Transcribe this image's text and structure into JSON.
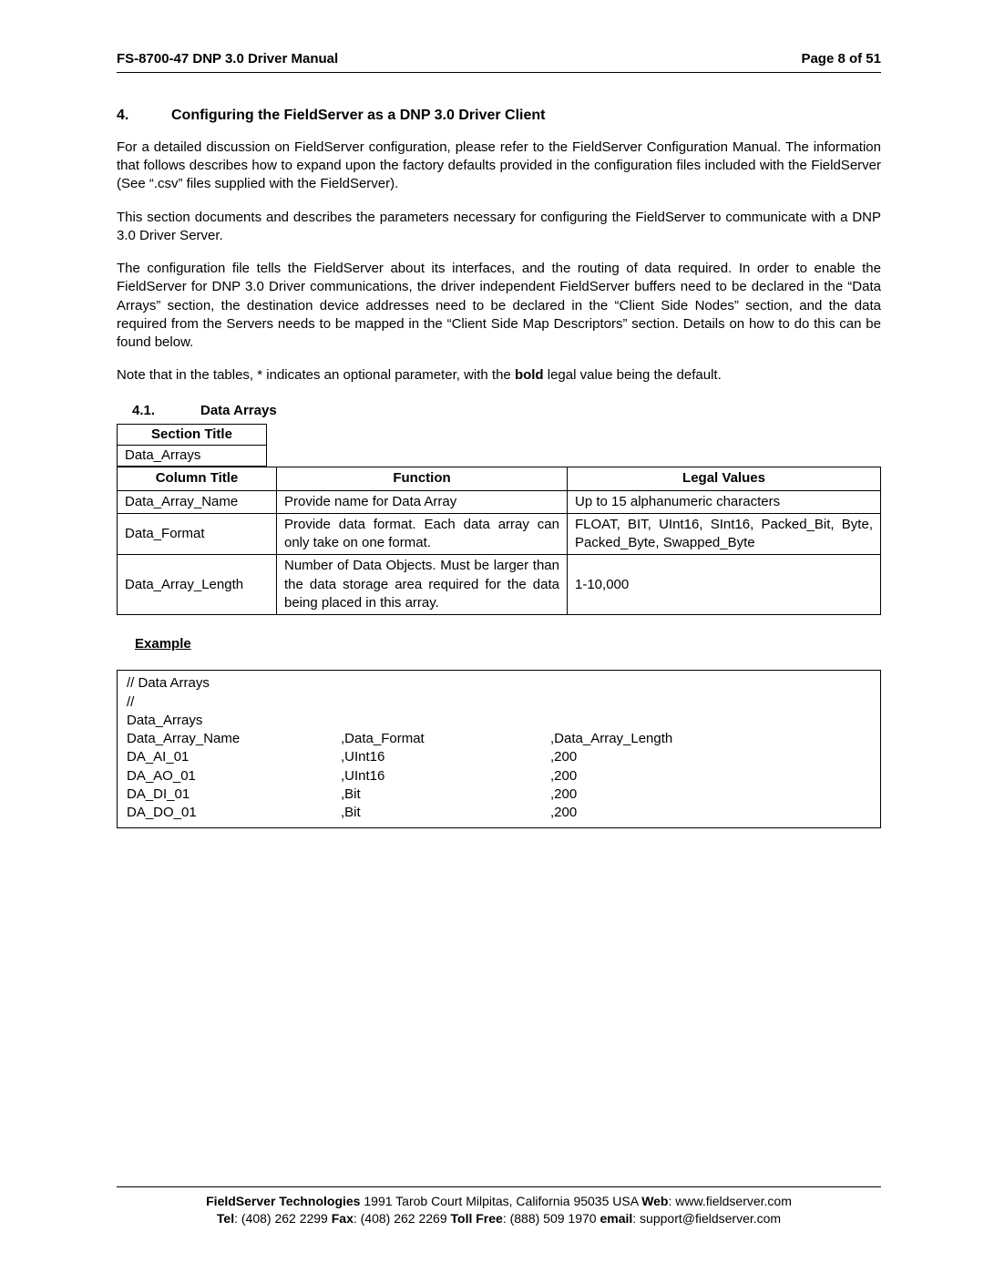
{
  "header": {
    "left": "FS-8700-47 DNP 3.0 Driver Manual",
    "right": "Page 8 of 51"
  },
  "section": {
    "num": "4.",
    "title": "Configuring the FieldServer as a DNP 3.0 Driver Client"
  },
  "para1": "For a detailed discussion on FieldServer configuration, please refer to the FieldServer Configuration Manual.  The information that follows describes how to expand upon the factory defaults provided in the configuration files included with the FieldServer (See “.csv” files supplied with the FieldServer).",
  "para2": "This section documents and describes the parameters necessary for configuring the FieldServer to communicate with a DNP 3.0 Driver Server.",
  "para3": "The configuration file tells the FieldServer about its interfaces, and the routing of data required. In order to enable the FieldServer for DNP 3.0 Driver communications, the driver independent FieldServer buffers need to be declared in the “Data Arrays” section, the destination device addresses need to be declared in the “Client Side Nodes” section, and the data required from the Servers needs to be mapped in the “Client Side Map Descriptors” section.  Details on how to do this can be found below.",
  "note_prefix": "Note that in the tables, * indicates an optional parameter, with the ",
  "note_bold": "bold",
  "note_suffix": " legal value being the default.",
  "subsection": {
    "num": "4.1.",
    "title": "Data Arrays"
  },
  "table_head": {
    "section_title_label": "Section Title",
    "section_title_value": "Data_Arrays",
    "column_title_label": "Column Title",
    "function_label": "Function",
    "legal_values_label": "Legal Values"
  },
  "table_rows": [
    {
      "col": "Data_Array_Name",
      "fn": "Provide name for Data Array",
      "lv": "Up to 15 alphanumeric characters"
    },
    {
      "col": "Data_Format",
      "fn": "Provide data format. Each data array can only take on one format.",
      "lv": "FLOAT, BIT, UInt16, SInt16, Packed_Bit, Byte, Packed_Byte, Swapped_Byte"
    },
    {
      "col": "Data_Array_Length",
      "fn": "Number of Data Objects. Must be larger than the data storage area required for the data being placed in this array.",
      "lv": "1-10,000"
    }
  ],
  "example_label": "Example",
  "code": {
    "comment": "//    Data Arrays",
    "comment2": "//",
    "section": "Data_Arrays",
    "header": {
      "c0": "Data_Array_Name",
      "c1": ",Data_Format",
      "c2": ",Data_Array_Length"
    },
    "rows": [
      {
        "c0": "DA_AI_01",
        "c1": ",UInt16",
        "c2": ",200"
      },
      {
        "c0": "DA_AO_01",
        "c1": ",UInt16",
        "c2": ",200"
      },
      {
        "c0": "DA_DI_01",
        "c1": ",Bit",
        "c2": ",200"
      },
      {
        "c0": "DA_DO_01",
        "c1": ",Bit",
        "c2": ",200"
      }
    ]
  },
  "footer": {
    "line1_company": "FieldServer Technologies",
    "line1_addr": " 1991 Tarob Court Milpitas, California 95035 USA   ",
    "line1_web_lbl": "Web",
    "line1_web": ": www.fieldserver.com",
    "tel_lbl": "Tel",
    "tel": ": (408) 262 2299   ",
    "fax_lbl": "Fax",
    "fax": ": (408) 262 2269   ",
    "tf_lbl": "Toll Free",
    "tf": ": (888) 509 1970   ",
    "em_lbl": "email",
    "em": ": support@fieldserver.com"
  }
}
